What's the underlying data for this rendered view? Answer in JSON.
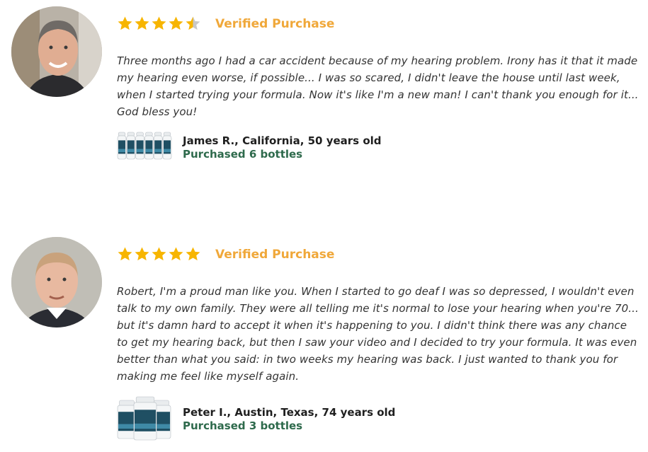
{
  "reviews": [
    {
      "rating": 4.5,
      "verified_label": "Verified Purchase",
      "text": "Three months ago I had a car accident because of my hearing problem. Irony has it that it made my hearing even worse, if possible... I was so scared, I didn't leave the house until last week, when I started trying your formula. Now it's like I'm a new man! I can't thank you enough for it... God bless you!",
      "author": "James R., California, 50 years old",
      "purchased": "Purchased 6 bottles",
      "bottle_count": 6
    },
    {
      "rating": 5,
      "verified_label": "Verified Purchase",
      "text": "Robert, I'm a proud man like you. When I started to go deaf I was so depressed, I wouldn't even talk to my own family. They were all telling me it's normal to lose your hearing when you're 70... but it's damn hard to accept it when it's happening to you. I didn't think there was any chance to get my hearing back, but then I saw your video and I decided to try your formula. It was even better than what you said: in two weeks my hearing was back. I just wanted to thank you for making me feel like myself again.",
      "author": "Peter I., Austin, Texas, 74 years old",
      "purchased": "Purchased 3 bottles",
      "bottle_count": 3
    }
  ],
  "colors": {
    "star": "#f7b500",
    "star_empty": "#c8c8c8",
    "verified": "#f0a83a",
    "purchased": "#2e6a4c"
  },
  "icons": {
    "star": "star-icon",
    "bottle": "product-bottle-icon"
  }
}
